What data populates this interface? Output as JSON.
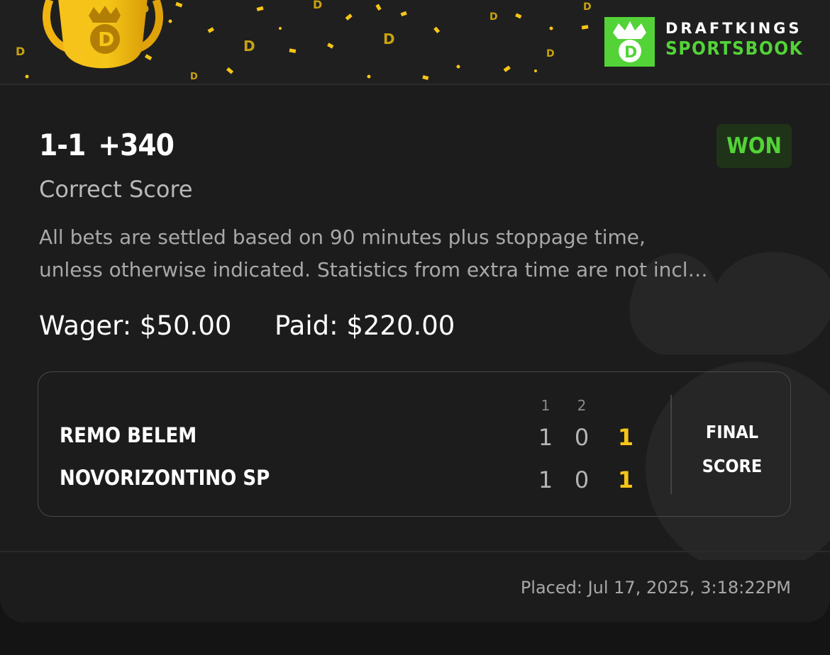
{
  "brand": {
    "line1": "DRAFTKINGS",
    "line2": "SPORTSBOOK",
    "logo_icon": "draftkings-crown-d-icon",
    "accent": "#53d337"
  },
  "banner": {
    "trophy_icon": "trophy-icon",
    "confetti_color": "#f5c518"
  },
  "bet": {
    "odds": "1-1 +340",
    "status": "WON",
    "market": "Correct Score",
    "description_line1": "All bets are settled based on 90 minutes plus stoppage time,",
    "description_line2": "unless otherwise indicated. Statistics from extra time are not incl…",
    "wager_label": "Wager: $50.00",
    "paid_label": "Paid: $220.00"
  },
  "scoreboard": {
    "period_headers": [
      "1",
      "2"
    ],
    "teams": [
      {
        "name": "REMO BELEM",
        "periods": [
          "1",
          "0"
        ],
        "total": "1"
      },
      {
        "name": "NOVORIZONTINO SP",
        "periods": [
          "1",
          "0"
        ],
        "total": "1"
      }
    ],
    "final_label_line1": "FINAL",
    "final_label_line2": "SCORE"
  },
  "footer": {
    "placed": "Placed: Jul 17, 2025, 3:18:22PM"
  },
  "colors": {
    "won_green": "#53d337",
    "total_yellow": "#f5c518"
  }
}
